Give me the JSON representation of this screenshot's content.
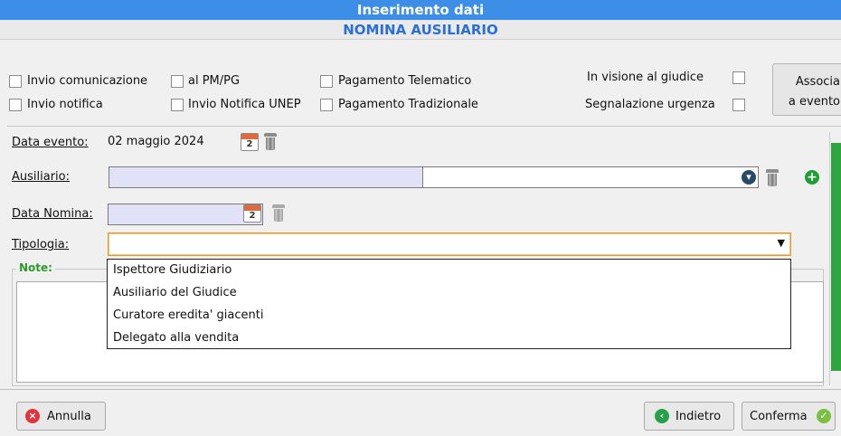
{
  "header": {
    "title": "Inserimento dati",
    "subtitle": "NOMINA AUSILIARIO"
  },
  "options": {
    "invio_comunicazione": "Invio comunicazione",
    "al_pm_pg": "al PM/PG",
    "pagamento_telematico": "Pagamento Telematico",
    "invio_notifica": "Invio notifica",
    "invio_notifica_unep": "Invio Notifica UNEP",
    "pagamento_tradizionale": "Pagamento Tradizionale",
    "in_visione": "In visione al giudice",
    "segnalazione_urgenza": "Segnalazione urgenza"
  },
  "associa_button": {
    "line1": "Associa",
    "line2": "a evento"
  },
  "form": {
    "data_evento_label": "Data evento:",
    "data_evento_value": "02 maggio 2024",
    "ausiliario_label": "Ausiliario:",
    "data_nomina_label": "Data Nomina:",
    "tipologia_label": "Tipologia:",
    "note_label": "Note:",
    "calendar_day": "2"
  },
  "tipologia_options": [
    "Ispettore Giudiziario",
    "Ausiliario del Giudice",
    "Curatore eredita' giacenti",
    "Delegato alla vendita"
  ],
  "buttons": {
    "annulla": "Annulla",
    "indietro": "Indietro",
    "conferma": "Conferma"
  },
  "colors": {
    "title_bg": "#3c8ee6",
    "subtitle_text": "#2a6fd6",
    "note_label": "#2e9a2e",
    "field_lavender": "#e1e2f7",
    "scroll_thumb": "#2fa53f"
  },
  "icons": [
    "calendar-icon",
    "trash-icon",
    "dropdown-circle-icon",
    "add-icon",
    "cancel-icon",
    "back-icon",
    "confirm-icon",
    "chevron-down-icon"
  ]
}
